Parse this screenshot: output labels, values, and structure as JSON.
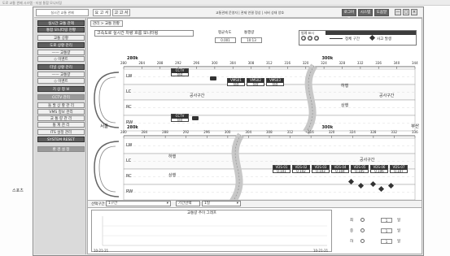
{
  "window": {
    "titlebar_text": "도로 교통 관제 시스템 - 터널 통합 모니터링",
    "side_label": "스포츠"
  },
  "header": {
    "brand": "실시간 교통 관제",
    "tab1": "요 고 서",
    "tab2": "고 고 서",
    "info": "교통관제 운영자 | 관제 연결 정상 | 서버 상태 양호",
    "buttons": [
      "로그아웃",
      "시스템",
      "도움말"
    ],
    "win_controls": [
      "—",
      "□",
      "×"
    ]
  },
  "sidebar": {
    "items": [
      {
        "label": "실시간 교통 관제",
        "style": "dark"
      },
      {
        "label": "통합 모니터링 현황",
        "style": "dark"
      },
      {
        "label": "교통 상황",
        "style": ""
      },
      {
        "label": "도로 상황 관리",
        "style": "dark"
      },
      {
        "label": "—— 교통량",
        "style": ""
      },
      {
        "label": "◇ 이벤트",
        "style": ""
      },
      {
        "label": "터널 상황 관리",
        "style": "dark"
      },
      {
        "label": "—— 교통량",
        "style": ""
      },
      {
        "label": "◇ 이벤트",
        "style": ""
      },
      {
        "label": "기 상 정 보",
        "style": "dark"
      },
      {
        "label": "CCTV 관리",
        "style": "mid"
      },
      {
        "label": "돌 발 상 황 관 리",
        "style": ""
      },
      {
        "label": "VMS 정보 관리",
        "style": ""
      },
      {
        "label": "교 통 량 관 리",
        "style": ""
      },
      {
        "label": "통 계 관 리",
        "style": ""
      },
      {
        "label": "ITS 설정 관리",
        "style": ""
      },
      {
        "label": "SYSTEM RESET",
        "style": "dark"
      },
      {
        "label": "환 경 설 정",
        "style": "mid"
      }
    ]
  },
  "main": {
    "breadcrumb": "관리 > 교통 현황",
    "caption": "고속도로 실시간 차량 흐름 모니터링",
    "stats": [
      {
        "label": "평균속도",
        "value": "0.001"
      },
      {
        "label": "통행량",
        "value": "10:13"
      }
    ],
    "legend": {
      "title": "범례 표시",
      "items": [
        "정체 구간",
        "사고 발생"
      ],
      "buttons": [
        "●",
        "●",
        "●"
      ]
    }
  },
  "section1": {
    "km_labels": [
      "280",
      "284",
      "288",
      "292",
      "296",
      "300",
      "304",
      "308",
      "312",
      "316",
      "320",
      "324",
      "328",
      "332",
      "336",
      "340",
      "344"
    ],
    "km_big": [
      "280k",
      "300k"
    ],
    "lanes": [
      "LW",
      "LC",
      "RC",
      "RW"
    ],
    "zones": [
      "공사구간",
      "하행",
      "상행",
      "공사구간"
    ],
    "box_labels": [
      {
        "top": "CCTV",
        "bottom": "정상"
      },
      {
        "top": "VMS01",
        "bottom": "정상"
      },
      {
        "top": "VMS02",
        "bottom": "정상"
      },
      {
        "top": "VMS03",
        "bottom": "정상"
      },
      {
        "top": "CCTV",
        "bottom": "정상"
      }
    ]
  },
  "section2": {
    "km_labels": [
      "280",
      "284",
      "288",
      "292",
      "296",
      "300",
      "304",
      "308",
      "312",
      "316",
      "320",
      "324",
      "328",
      "332",
      "336"
    ],
    "km_big": [
      "280k",
      "300k"
    ],
    "lanes": [
      "LW",
      "LC",
      "RC",
      "RW"
    ],
    "zones": [
      "하행",
      "상행",
      "공사구간"
    ],
    "end_labels": [
      "서울",
      "부산"
    ],
    "box_labels": [
      {
        "top": "VDS-01",
        "bottom": "0.101"
      },
      {
        "top": "VDS-02",
        "bottom": "0.102"
      },
      {
        "top": "VDS-03",
        "bottom": "0.103"
      },
      {
        "top": "VDS-04",
        "bottom": "0.104"
      },
      {
        "top": "VDS-05",
        "bottom": "0.105"
      },
      {
        "top": "VDS-06",
        "bottom": "0.106"
      },
      {
        "top": "VDS-07",
        "bottom": "0.107"
      }
    ]
  },
  "bottom": {
    "dd1_label": "선택구간",
    "dd1_value": "1구간",
    "dd2_label": "기간선택",
    "dd2_value": "1일",
    "chart_title": "교통량 추이 그래프",
    "x_start": "10-21-21",
    "x_end": "10-21-21",
    "panel": [
      {
        "label": "최",
        "value": "1",
        "unit": "일"
      },
      {
        "label": "중",
        "value": "1",
        "unit": "일"
      },
      {
        "label": "하",
        "value": "1",
        "unit": "일"
      }
    ]
  }
}
